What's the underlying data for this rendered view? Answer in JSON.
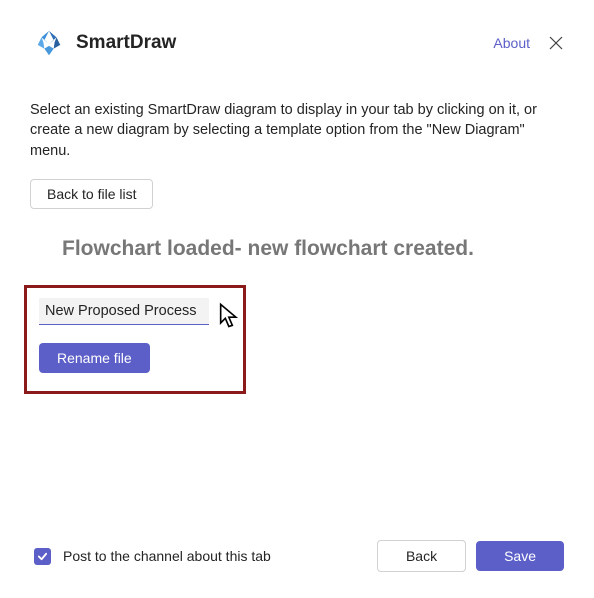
{
  "header": {
    "app_title": "SmartDraw",
    "about_label": "About"
  },
  "instructions": "Select an existing SmartDraw diagram to display in your tab by clicking on it, or create a new diagram by selecting a template option from the \"New Diagram\" menu.",
  "back_to_list_label": "Back to file list",
  "status_message": "Flowchart loaded- new flowchart created.",
  "rename": {
    "filename_value": "New Proposed Process",
    "rename_label": "Rename file"
  },
  "footer": {
    "checkbox_checked": true,
    "checkbox_label": "Post to the channel about this tab",
    "back_label": "Back",
    "save_label": "Save"
  }
}
